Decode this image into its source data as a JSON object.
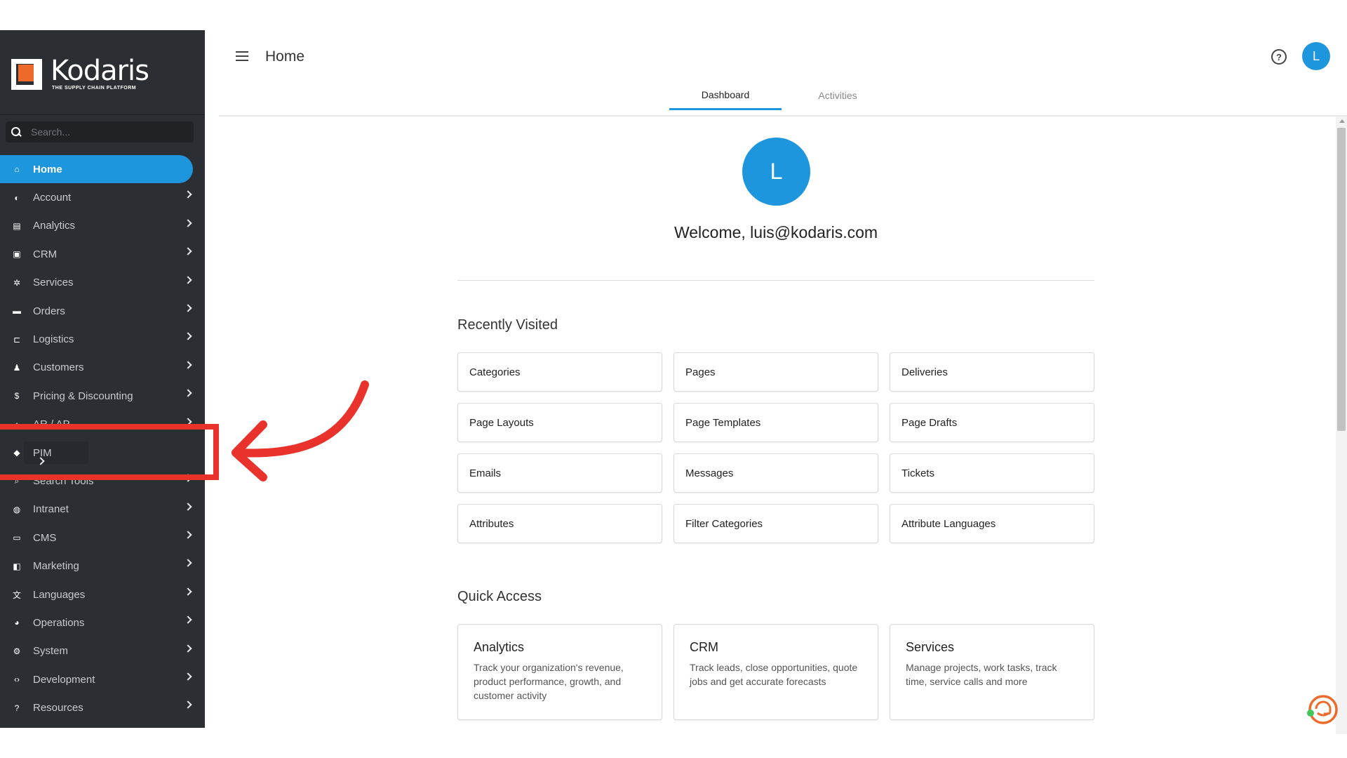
{
  "brand": {
    "name": "Kodaris",
    "tagline": "THE SUPPLY CHAIN PLATFORM"
  },
  "search": {
    "placeholder": "Search..."
  },
  "sidebar": {
    "items": [
      {
        "label": "Home",
        "icon": "home-icon",
        "glyph": "⌂"
      },
      {
        "label": "Account",
        "icon": "user-icon",
        "glyph": "◐"
      },
      {
        "label": "Analytics",
        "icon": "chart-icon",
        "glyph": "▤"
      },
      {
        "label": "CRM",
        "icon": "contact-card-icon",
        "glyph": "▣"
      },
      {
        "label": "Services",
        "icon": "gears-icon",
        "glyph": "✲"
      },
      {
        "label": "Orders",
        "icon": "truck-icon",
        "glyph": "▬"
      },
      {
        "label": "Logistics",
        "icon": "shipping-icon",
        "glyph": "⊏"
      },
      {
        "label": "Customers",
        "icon": "users-icon",
        "glyph": "♟"
      },
      {
        "label": "Pricing & Discounting",
        "icon": "dollar-icon",
        "glyph": "$"
      },
      {
        "label": "AR / AP",
        "icon": "bank-icon",
        "glyph": "⌂"
      },
      {
        "label": "PIM",
        "icon": "tag-icon",
        "glyph": "◆"
      },
      {
        "label": "Search Tools",
        "icon": "search-icon",
        "glyph": "⌕"
      },
      {
        "label": "Intranet",
        "icon": "globe-icon",
        "glyph": "◍"
      },
      {
        "label": "CMS",
        "icon": "window-icon",
        "glyph": "▭"
      },
      {
        "label": "Marketing",
        "icon": "megaphone-icon",
        "glyph": "◧"
      },
      {
        "label": "Languages",
        "icon": "translate-icon",
        "glyph": "文"
      },
      {
        "label": "Operations",
        "icon": "palette-icon",
        "glyph": "◕"
      },
      {
        "label": "System",
        "icon": "gear-icon",
        "glyph": "⚙"
      },
      {
        "label": "Development",
        "icon": "code-icon",
        "glyph": "‹›"
      },
      {
        "label": "Resources",
        "icon": "help-circle-icon",
        "glyph": "?"
      }
    ]
  },
  "header": {
    "title": "Home"
  },
  "tabs": [
    {
      "label": "Dashboard"
    },
    {
      "label": "Activities"
    }
  ],
  "user": {
    "initial": "L",
    "email": "luis@kodaris.com"
  },
  "welcome": "Welcome, luis@kodaris.com",
  "recently_visited": {
    "title": "Recently Visited",
    "items": [
      "Categories",
      "Pages",
      "Deliveries",
      "Page Layouts",
      "Page Templates",
      "Page Drafts",
      "Emails",
      "Messages",
      "Tickets",
      "Attributes",
      "Filter Categories",
      "Attribute Languages"
    ]
  },
  "quick_access": {
    "title": "Quick Access",
    "items": [
      {
        "title": "Analytics",
        "description": "Track your organization's revenue, product performance, growth, and customer activity"
      },
      {
        "title": "CRM",
        "description": "Track leads, close opportunities, quote jobs and get accurate forecasts"
      },
      {
        "title": "Services",
        "description": "Manage projects, work tasks, track time, service calls and more"
      }
    ]
  },
  "colors": {
    "sidebar_bg": "#2b2f33",
    "accent": "#1e96dd",
    "brand_orange": "#ee6a2b",
    "annotation_red": "#e8322b"
  }
}
